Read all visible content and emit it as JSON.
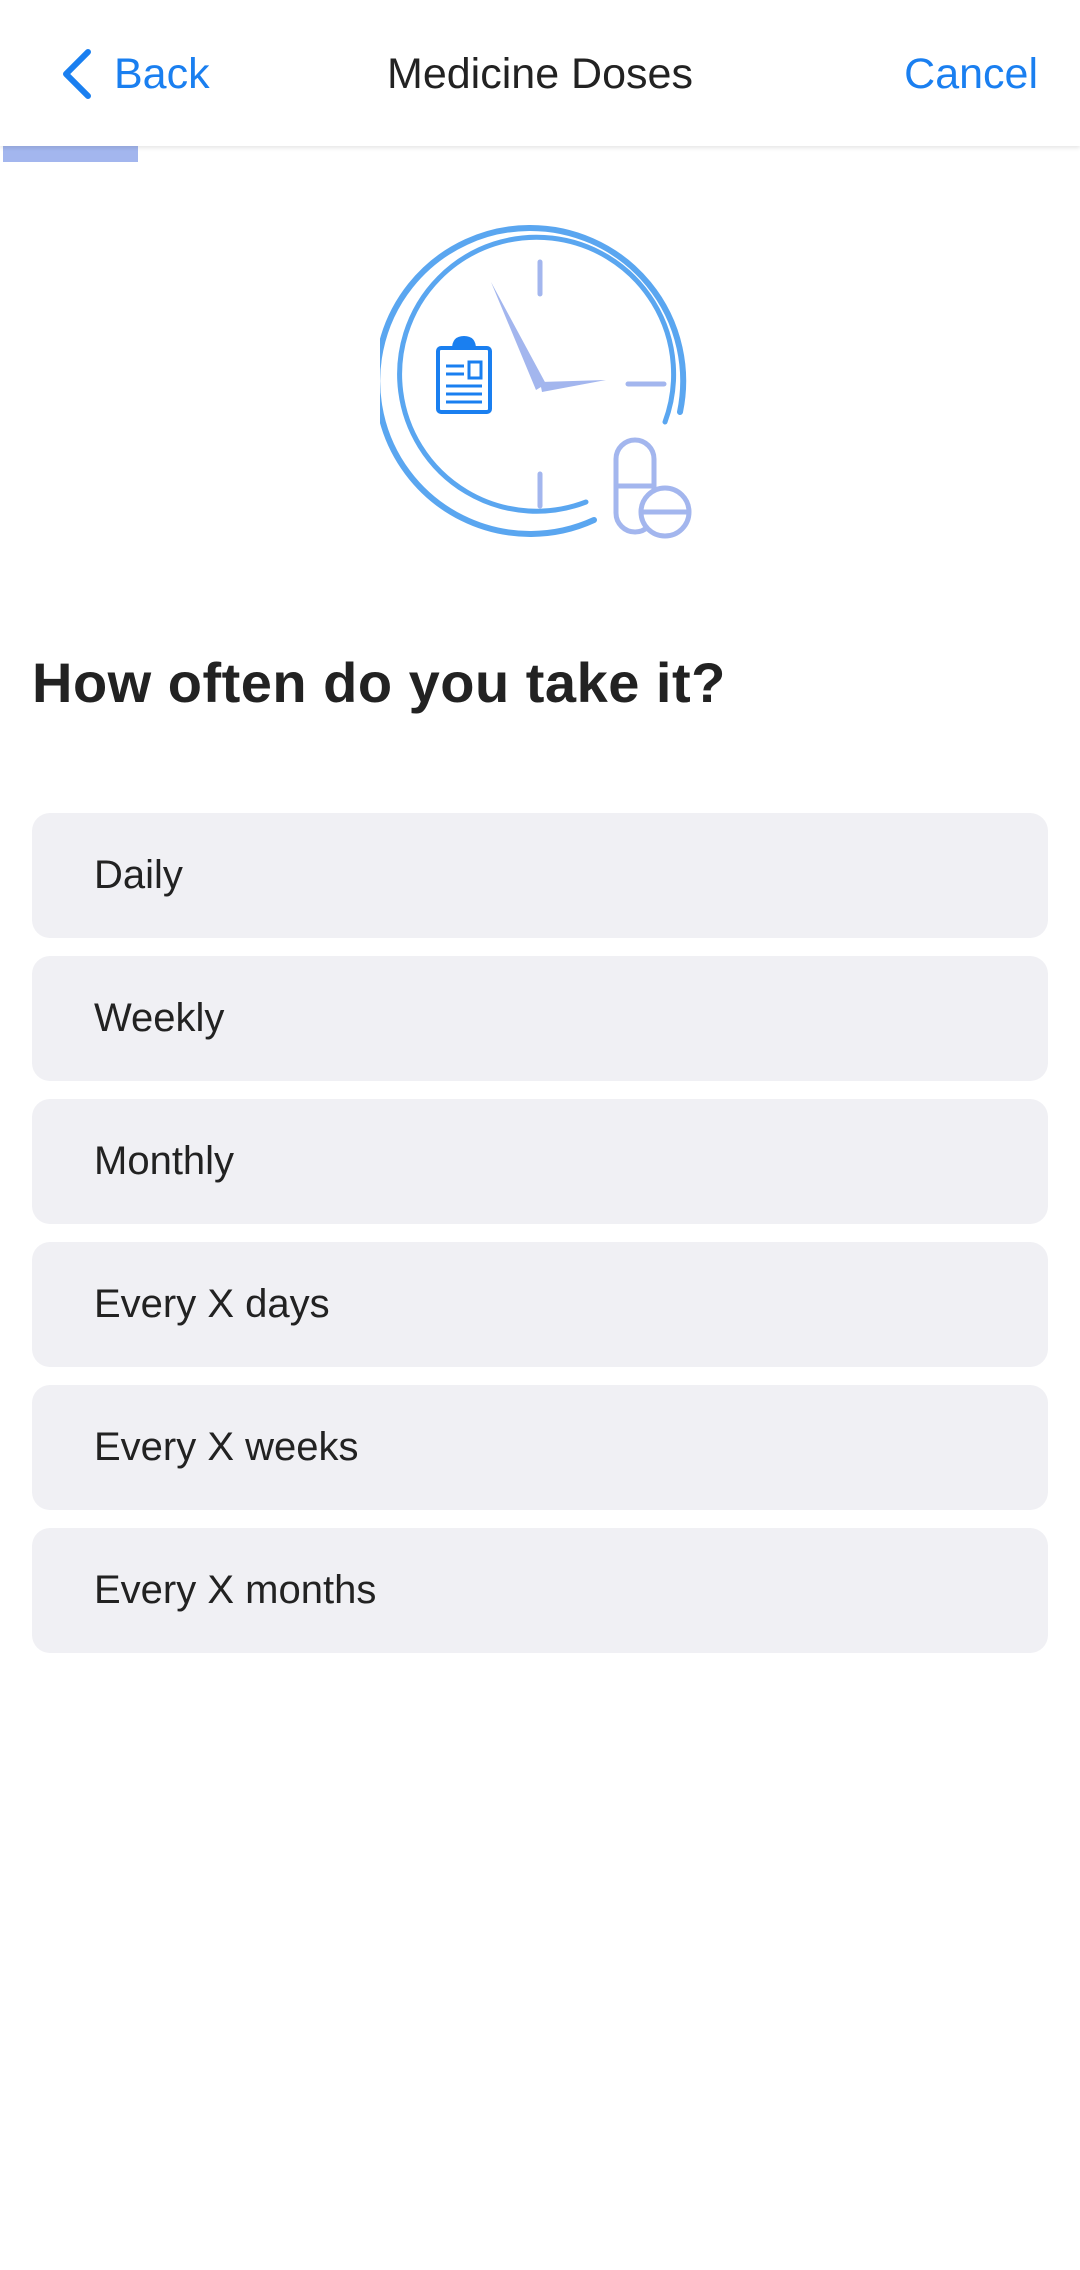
{
  "header": {
    "back_label": "Back",
    "title": "Medicine Doses",
    "cancel_label": "Cancel"
  },
  "progress": {
    "fraction": 0.125
  },
  "illustration": {
    "icon": "clock-with-clipboard-and-pill-icon"
  },
  "question": "How often do you take it?",
  "options": [
    {
      "label": "Daily"
    },
    {
      "label": "Weekly"
    },
    {
      "label": "Monthly"
    },
    {
      "label": "Every X days"
    },
    {
      "label": "Every X weeks"
    },
    {
      "label": "Every X months"
    }
  ],
  "colors": {
    "accent": "#1a7ff0",
    "progress": "#a3b6ee",
    "illustration_primary": "#5aa6f0",
    "illustration_secondary": "#a3b6ee",
    "option_background": "#f0f0f4"
  }
}
